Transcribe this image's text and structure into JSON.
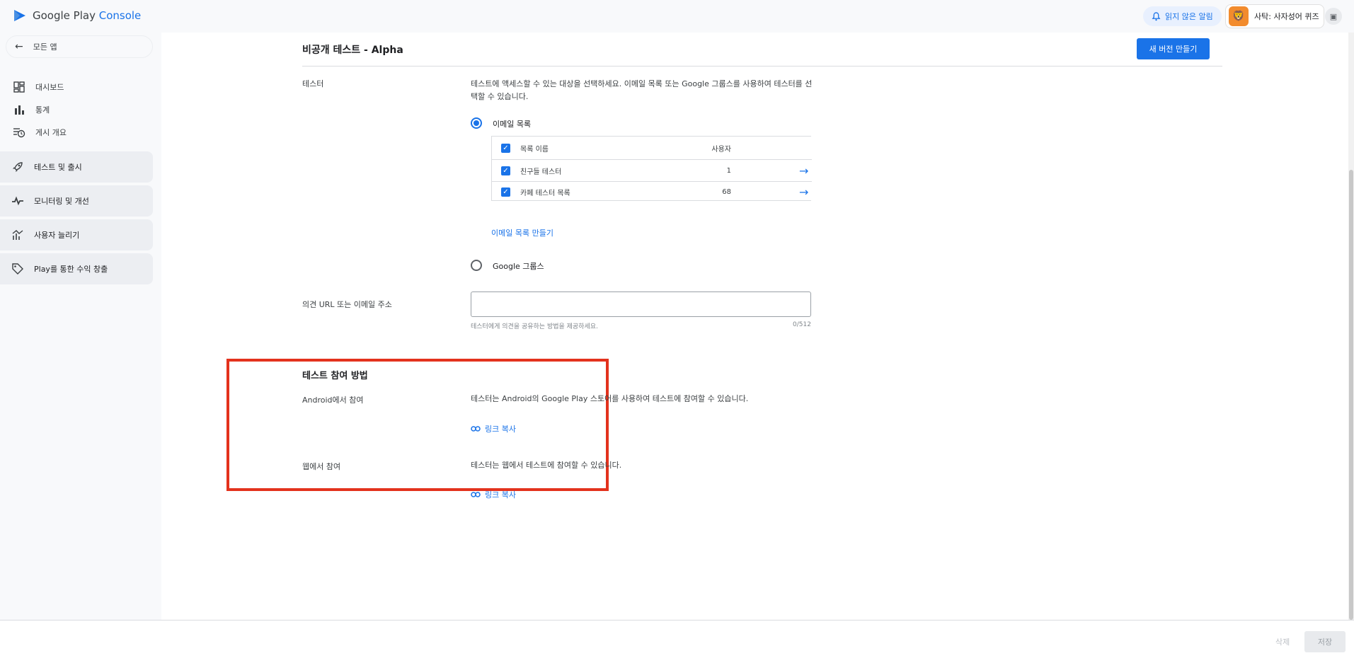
{
  "app": {
    "logo_text_google_play": "Google Play",
    "logo_text_console": "Console"
  },
  "topbar": {
    "unread_notifications": "읽지 않은 알림",
    "account_name": "사탁: 사자성어 퀴즈"
  },
  "sidebar": {
    "back_label": "모든 앱",
    "items": [
      {
        "label": "대시보드",
        "icon": "dashboard-icon"
      },
      {
        "label": "통계",
        "icon": "bar-chart-icon"
      },
      {
        "label": "게시 개요",
        "icon": "publish-overview-icon"
      }
    ],
    "groups": [
      {
        "label": "테스트 및 출시",
        "icon": "rocket-icon"
      },
      {
        "label": "모니터링 및 개선",
        "icon": "vitals-icon"
      },
      {
        "label": "사용자 늘리기",
        "icon": "growth-icon"
      },
      {
        "label": "Play를 통한 수익 창출",
        "icon": "tag-icon"
      }
    ]
  },
  "page": {
    "title": "비공개 테스트 - Alpha",
    "create_release_button": "새 버전 만들기",
    "testers_label": "테스터",
    "testers_desc": "테스트에 액세스할 수 있는 대상을 선택하세요. 이메일 목록 또는 Google 그룹스를 사용하여 테스터를 선택할 수 있습니다.",
    "email_list_option": "이메일 목록",
    "google_groups_option": "Google 그룹스",
    "table": {
      "col_list_name": "목록 이름",
      "col_users": "사용자",
      "rows": [
        {
          "name": "친구들 테스터",
          "users": "1"
        },
        {
          "name": "카페 테스터 목록",
          "users": "68"
        }
      ]
    },
    "create_email_list_link": "이메일 목록 만들기",
    "feedback_label": "의견 URL 또는 이메일 주소",
    "feedback_value": "",
    "feedback_helper": "테스터에게 의견을 공유하는 방법을 제공하세요.",
    "feedback_counter": "0/512",
    "join_section": {
      "title": "테스트 참여 방법",
      "android_label": "Android에서 참여",
      "android_desc": "테스터는 Android의 Google Play 스토어를 사용하여 테스트에 참여할 수 있습니다.",
      "web_label": "웹에서 참여",
      "web_desc": "테스터는 웹에서 테스트에 참여할 수 있습니다.",
      "copy_link": "링크 복사"
    }
  },
  "footer": {
    "delete": "삭제",
    "save": "저장"
  },
  "colors": {
    "accent": "#1a73e8",
    "highlight": "#e3321d"
  }
}
